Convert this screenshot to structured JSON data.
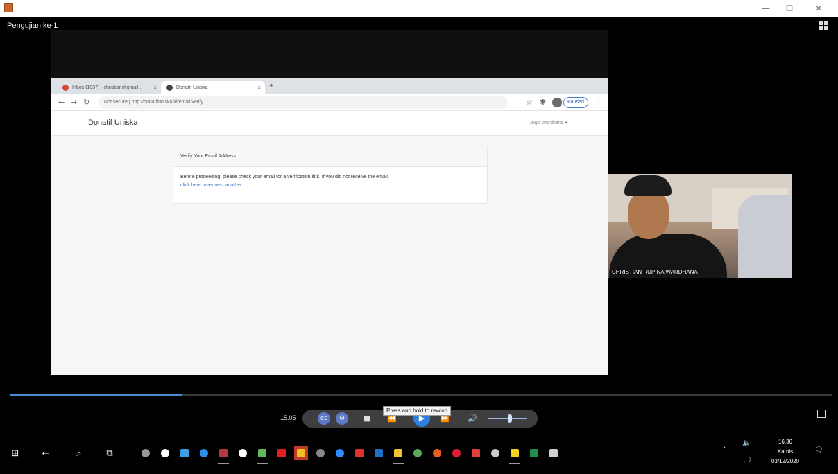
{
  "window": {
    "meeting_title": "Pengujian ke-1",
    "controls": {
      "minimize": "—",
      "maximize": "☐",
      "close": "✕"
    }
  },
  "browser": {
    "tabs": [
      {
        "label": "Inbox (1037) - christian@gmail...",
        "favicon_color": "#d44638",
        "close": "×"
      },
      {
        "label": "Donatif Uniska",
        "favicon_color": "#444444",
        "close": "×"
      }
    ],
    "new_tab": "+",
    "nav": {
      "back": "←",
      "forward": "→",
      "reload": "↻",
      "star": "☆",
      "puzzle": "✱",
      "more": "⋮"
    },
    "address": "Not secure | http://donatifuniska.id/email/verify",
    "paused_label": "Paused"
  },
  "site": {
    "brand": "Donatif Uniska",
    "user_menu": "Jugo Wardhana ▾",
    "card_title": "Verify Your Email Address",
    "card_text": "Before proceeding, please check your email for a verification link. If you did not receive the email,",
    "card_link": "click here to request another"
  },
  "participant": {
    "name": "CHRISTIAN RUPINA WARDHANA"
  },
  "playback": {
    "time": "15.05",
    "progress": 0.21,
    "tooltip": "Press and hold to rewind",
    "buttons": {
      "cc": "cc",
      "settings": "⚙",
      "stop": "■",
      "rewind": "⏪",
      "play": "▶",
      "forward": "⏩",
      "volume": "🔊"
    },
    "volume_level": 0.55
  },
  "taskbar": {
    "icons": [
      {
        "name": "start-icon",
        "glyph": "⊞"
      },
      {
        "name": "back-icon",
        "glyph": "←"
      },
      {
        "name": "search-icon",
        "glyph": "⌕"
      },
      {
        "name": "task-view-icon",
        "glyph": "⧉"
      }
    ],
    "apps": [
      {
        "name": "app-pin-icon",
        "color": "#9a9a9a",
        "shape": "dot"
      },
      {
        "name": "app-chrome-icon",
        "color": "#ffffff",
        "shape": "dot"
      },
      {
        "name": "app-people-icon",
        "color": "#3aa0e8",
        "shape": "sq"
      },
      {
        "name": "app-edge-icon",
        "color": "#2c8ee8",
        "shape": "dot"
      },
      {
        "name": "app-book-icon",
        "color": "#b23a3a",
        "shape": "sq",
        "open": true
      },
      {
        "name": "app-clock-icon",
        "color": "#ffffff",
        "shape": "dot"
      },
      {
        "name": "app-paint-icon",
        "color": "#5fb85a",
        "shape": "sq",
        "open": true
      },
      {
        "name": "app-acrobat-icon",
        "color": "#e02020",
        "shape": "sq"
      },
      {
        "name": "app-recorder-icon",
        "color": "#f0c020",
        "shape": "sq",
        "active": true
      },
      {
        "name": "app-settings-icon",
        "color": "#888888",
        "shape": "dot"
      },
      {
        "name": "app-zoom-icon",
        "color": "#2d8cff",
        "shape": "dot"
      },
      {
        "name": "app-office-icon",
        "color": "#e23030",
        "shape": "sq"
      },
      {
        "name": "app-outlook-icon",
        "color": "#1f6fc8",
        "shape": "sq"
      },
      {
        "name": "app-explorer-icon",
        "color": "#f2c232",
        "shape": "sq",
        "open": true
      },
      {
        "name": "app-maps-icon",
        "color": "#5ca85c",
        "shape": "dot"
      },
      {
        "name": "app-firefox-icon",
        "color": "#e85d20",
        "shape": "dot"
      },
      {
        "name": "app-opera-icon",
        "color": "#e02030",
        "shape": "dot"
      },
      {
        "name": "app-photos-icon",
        "color": "#e04040",
        "shape": "sq"
      },
      {
        "name": "app-weather-icon",
        "color": "#cccccc",
        "shape": "dot"
      },
      {
        "name": "app-notes-icon",
        "color": "#f5d020",
        "shape": "sq",
        "open": true
      },
      {
        "name": "app-excel-icon",
        "color": "#1e8e4a",
        "shape": "sq"
      },
      {
        "name": "app-misc-icon",
        "color": "#cfcfcf",
        "shape": "sq"
      }
    ],
    "tray": {
      "chevron": "⌃",
      "speaker": "🔈",
      "network": "🖵",
      "notification": "🗨"
    },
    "clock": {
      "time": "16.36",
      "day": "Kamis",
      "date": "03/12/2020"
    }
  }
}
